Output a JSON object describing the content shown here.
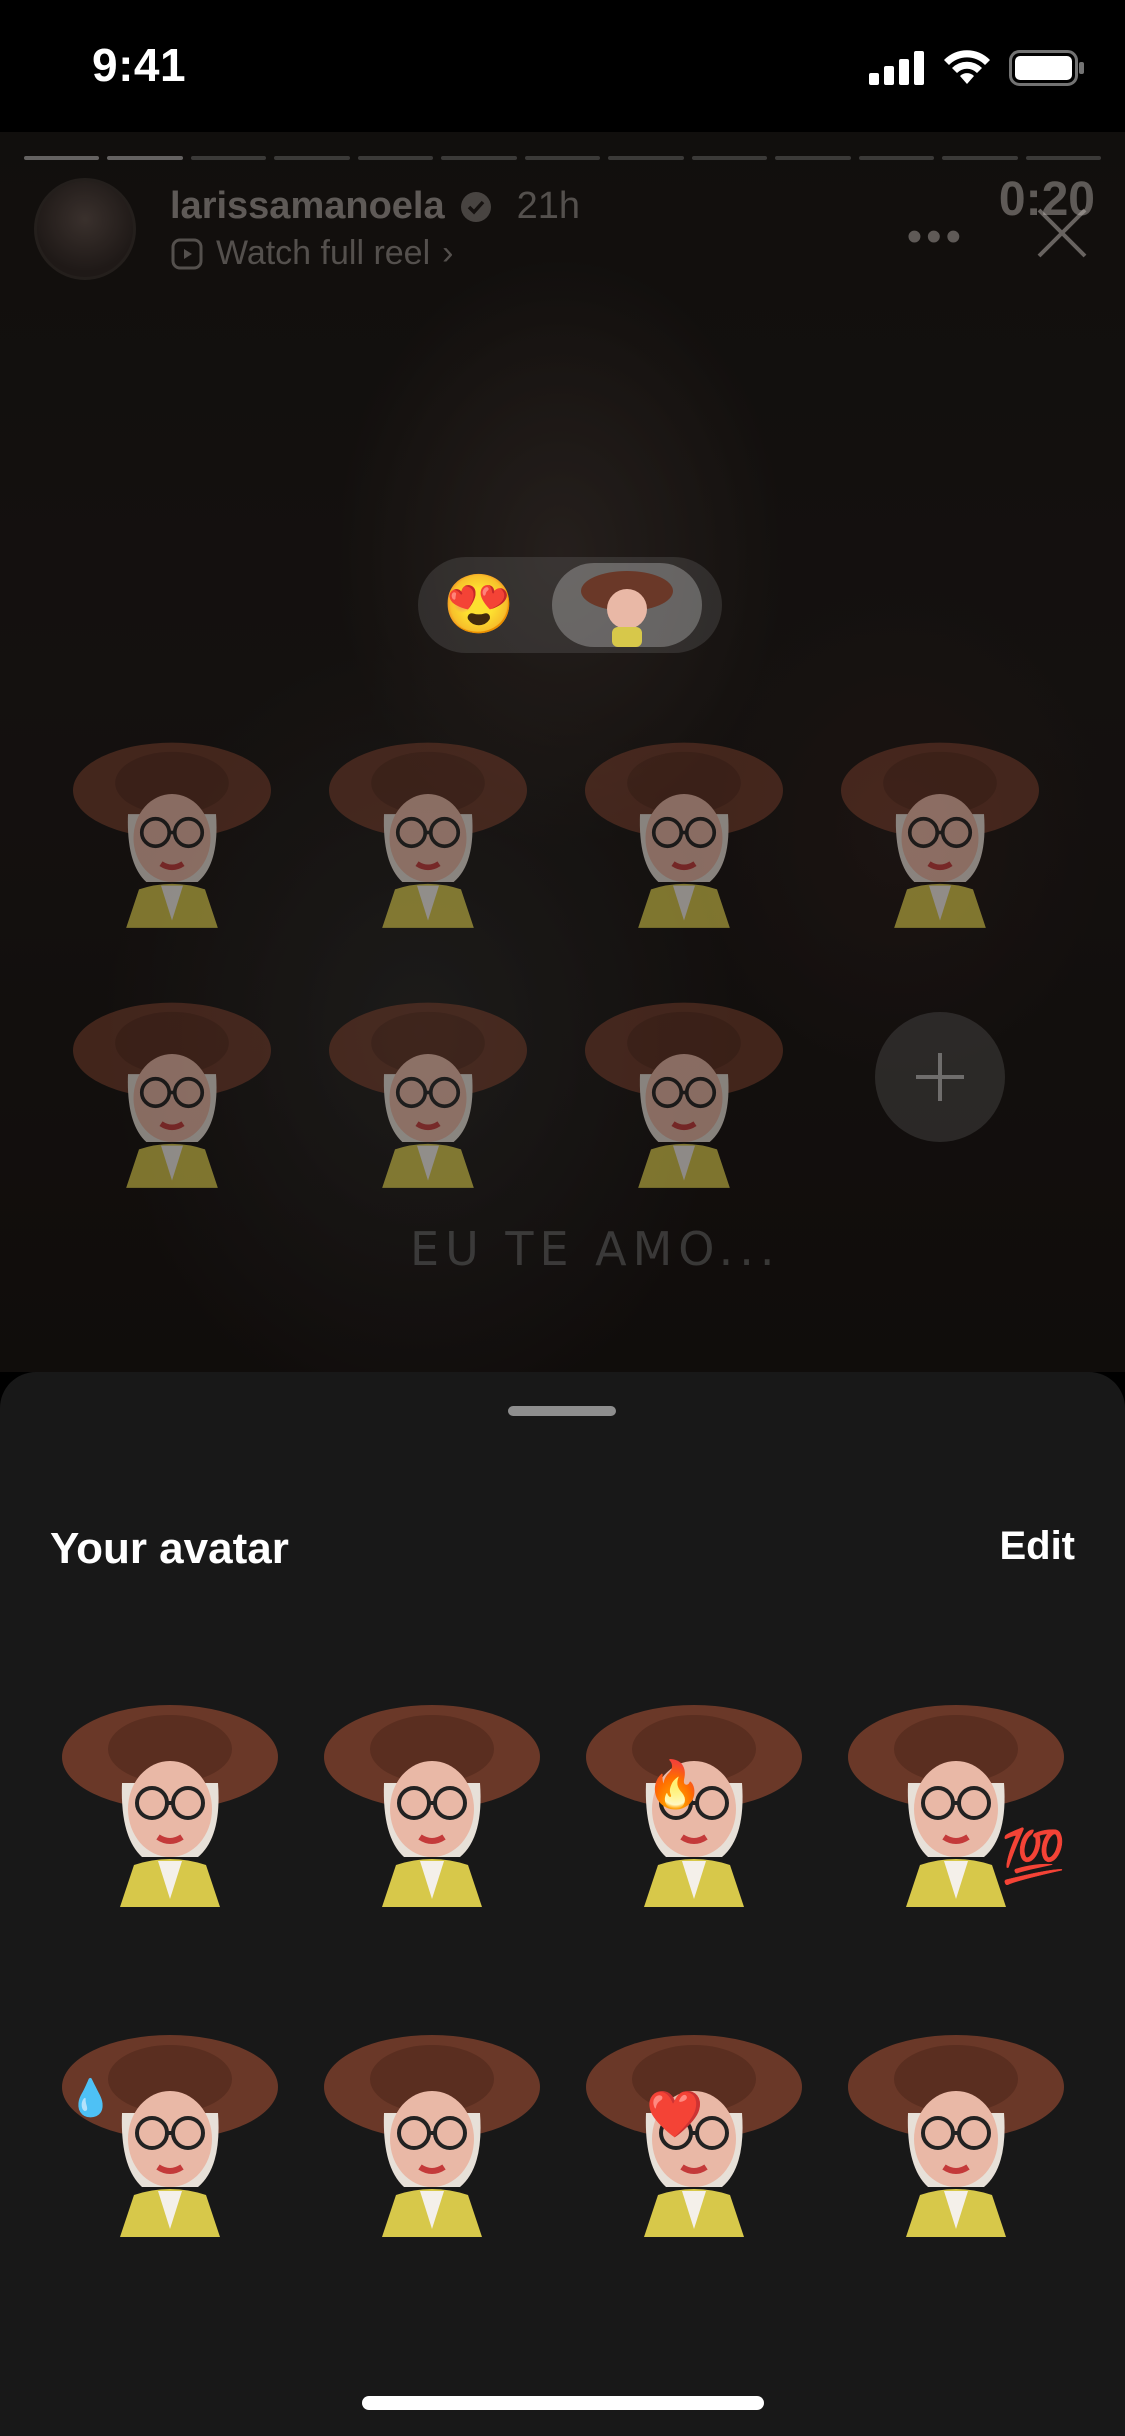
{
  "status_bar": {
    "time": "9:41"
  },
  "story": {
    "username": "larissamanoela",
    "posted_time": "21h",
    "subtitle": "Watch full reel",
    "subtitle_chevron": "›",
    "timer": "0:20",
    "more": "•••",
    "overlay_text": "EU TE AMO...",
    "progress_segments": 13,
    "progress_done": 2,
    "reaction_emoji": "😍"
  },
  "sheet": {
    "title": "Your avatar",
    "edit_label": "Edit"
  },
  "story_stickers": [
    {
      "name": "avatar-sticker-shy"
    },
    {
      "name": "avatar-sticker-hair-touch"
    },
    {
      "name": "avatar-sticker-kiss-heart"
    },
    {
      "name": "avatar-sticker-cheer"
    },
    {
      "name": "avatar-sticker-balloon"
    },
    {
      "name": "avatar-sticker-coffee"
    },
    {
      "name": "avatar-sticker-smile"
    }
  ],
  "sheet_stickers": [
    {
      "name": "avatar-sticker-neutral",
      "badge": ""
    },
    {
      "name": "avatar-sticker-sad",
      "badge": ""
    },
    {
      "name": "avatar-sticker-fire-eyes",
      "badge": "🔥"
    },
    {
      "name": "avatar-sticker-100",
      "badge": "💯"
    },
    {
      "name": "avatar-sticker-laugh-tears",
      "badge": "💧"
    },
    {
      "name": "avatar-sticker-clap",
      "badge": ""
    },
    {
      "name": "avatar-sticker-heart-eyes",
      "badge": "❤️"
    },
    {
      "name": "avatar-sticker-tilted",
      "badge": ""
    }
  ],
  "colors": {
    "hat": "#6a3828",
    "skin": "#e9b8a6",
    "hair": "#e7e0d8",
    "jacket": "#d7c84a",
    "sheet_bg": "#181818"
  }
}
